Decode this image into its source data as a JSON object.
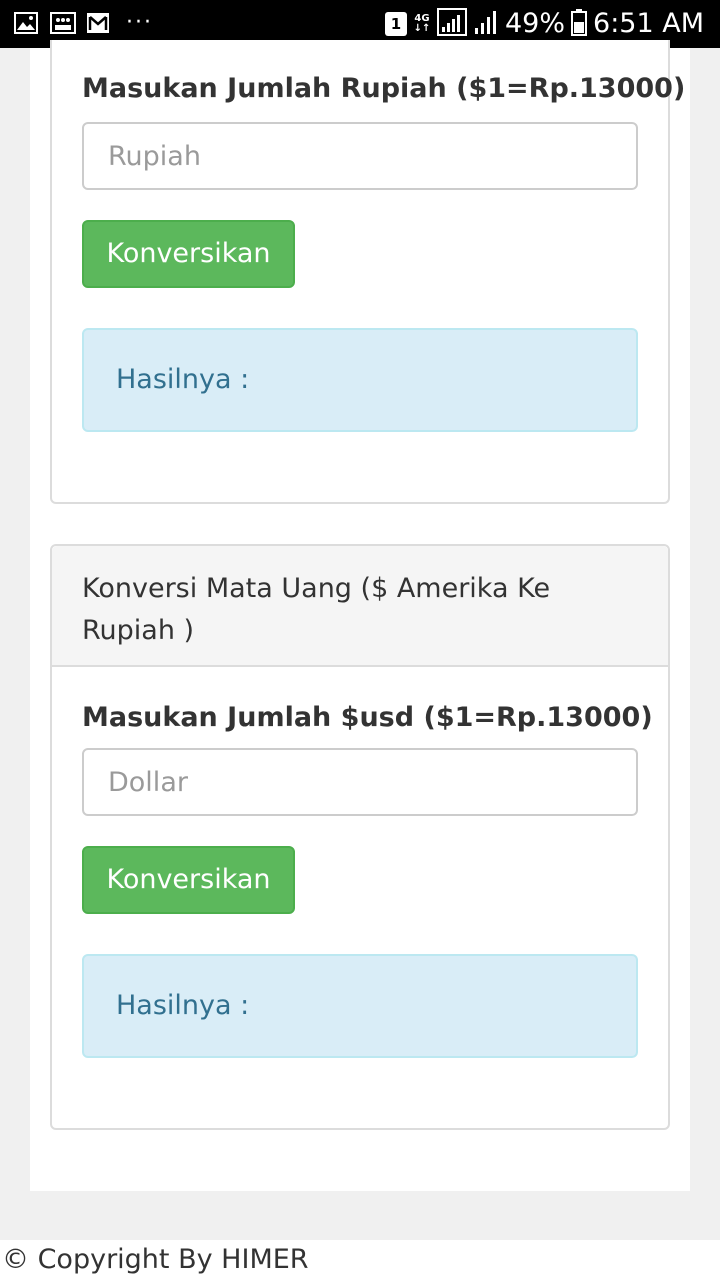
{
  "status_bar": {
    "sim_badge": "1",
    "network_top": "4G",
    "network_bottom": "↓↑",
    "battery_percent": "49%",
    "time": "6:51 AM"
  },
  "panels": [
    {
      "label": "Masukan Jumlah Rupiah ($1=Rp.13000)",
      "input_placeholder": "Rupiah",
      "input_value": "",
      "button_label": "Konversikan",
      "result_label": "Hasilnya :"
    },
    {
      "heading": "Konversi Mata Uang ($ Amerika Ke Rupiah )",
      "label": "Masukan Jumlah $usd ($1=Rp.13000)",
      "input_placeholder": "Dollar",
      "input_value": "",
      "button_label": "Konversikan",
      "result_label": "Hasilnya :"
    }
  ],
  "footer": {
    "copyright": "© Copyright By HIMER"
  },
  "colors": {
    "button_green": "#5cb85c",
    "alert_bg": "#d9edf7",
    "alert_text": "#31708f",
    "panel_heading_bg": "#f5f5f5"
  },
  "icons": {
    "status_left": [
      "gallery-icon",
      "notification-icon",
      "gmail-icon",
      "more-dots-icon"
    ],
    "status_right": [
      "sim-badge-icon",
      "wifi-icon",
      "signal-icon",
      "battery-icon"
    ]
  }
}
